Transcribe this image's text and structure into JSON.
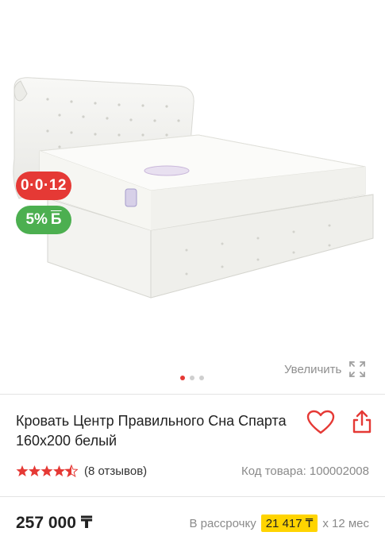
{
  "product": {
    "title": "Кровать Центр Правильного Сна Спарта 160x200 белый",
    "reviews": "(8 отзывов)",
    "sku": "Код товара: 100002008",
    "price": "257 000 ₸",
    "rating": 4.5
  },
  "badges": {
    "timer": "0·0·12",
    "bonus": "5%",
    "bonus_unit": "Б"
  },
  "gallery": {
    "enlarge_label": "Увеличить",
    "slide_count": 3,
    "active_slide": 1
  },
  "installment": {
    "prefix": "В рассрочку",
    "amount": "21 417 ₸",
    "suffix": "x 12 мес"
  },
  "colors": {
    "accent": "#e53935",
    "bonus_green": "#4caf50",
    "installment_highlight": "#ffd400"
  },
  "icons": [
    "heart-icon",
    "share-icon",
    "expand-icon",
    "star-icon"
  ]
}
